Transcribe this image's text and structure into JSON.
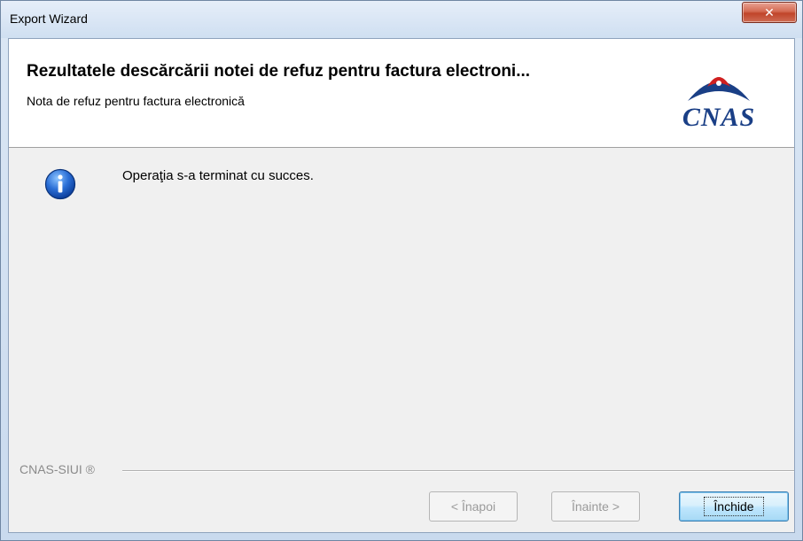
{
  "window": {
    "title": "Export Wizard",
    "close_glyph": "✕"
  },
  "header": {
    "title": "Rezultatele descărcării notei de refuz pentru factura electroni...",
    "subtitle": "Nota de refuz pentru factura electronică",
    "logo_text": "CNAS"
  },
  "body": {
    "icon": "info-icon",
    "message": "Operaţia s-a terminat cu succes."
  },
  "footer": {
    "brand": "CNAS-SIUI ®"
  },
  "buttons": {
    "back": "< Înapoi",
    "next": "Înainte >",
    "close": "Închide"
  },
  "colors": {
    "accent": "#1a3f86",
    "close_button": "#c0442a"
  }
}
